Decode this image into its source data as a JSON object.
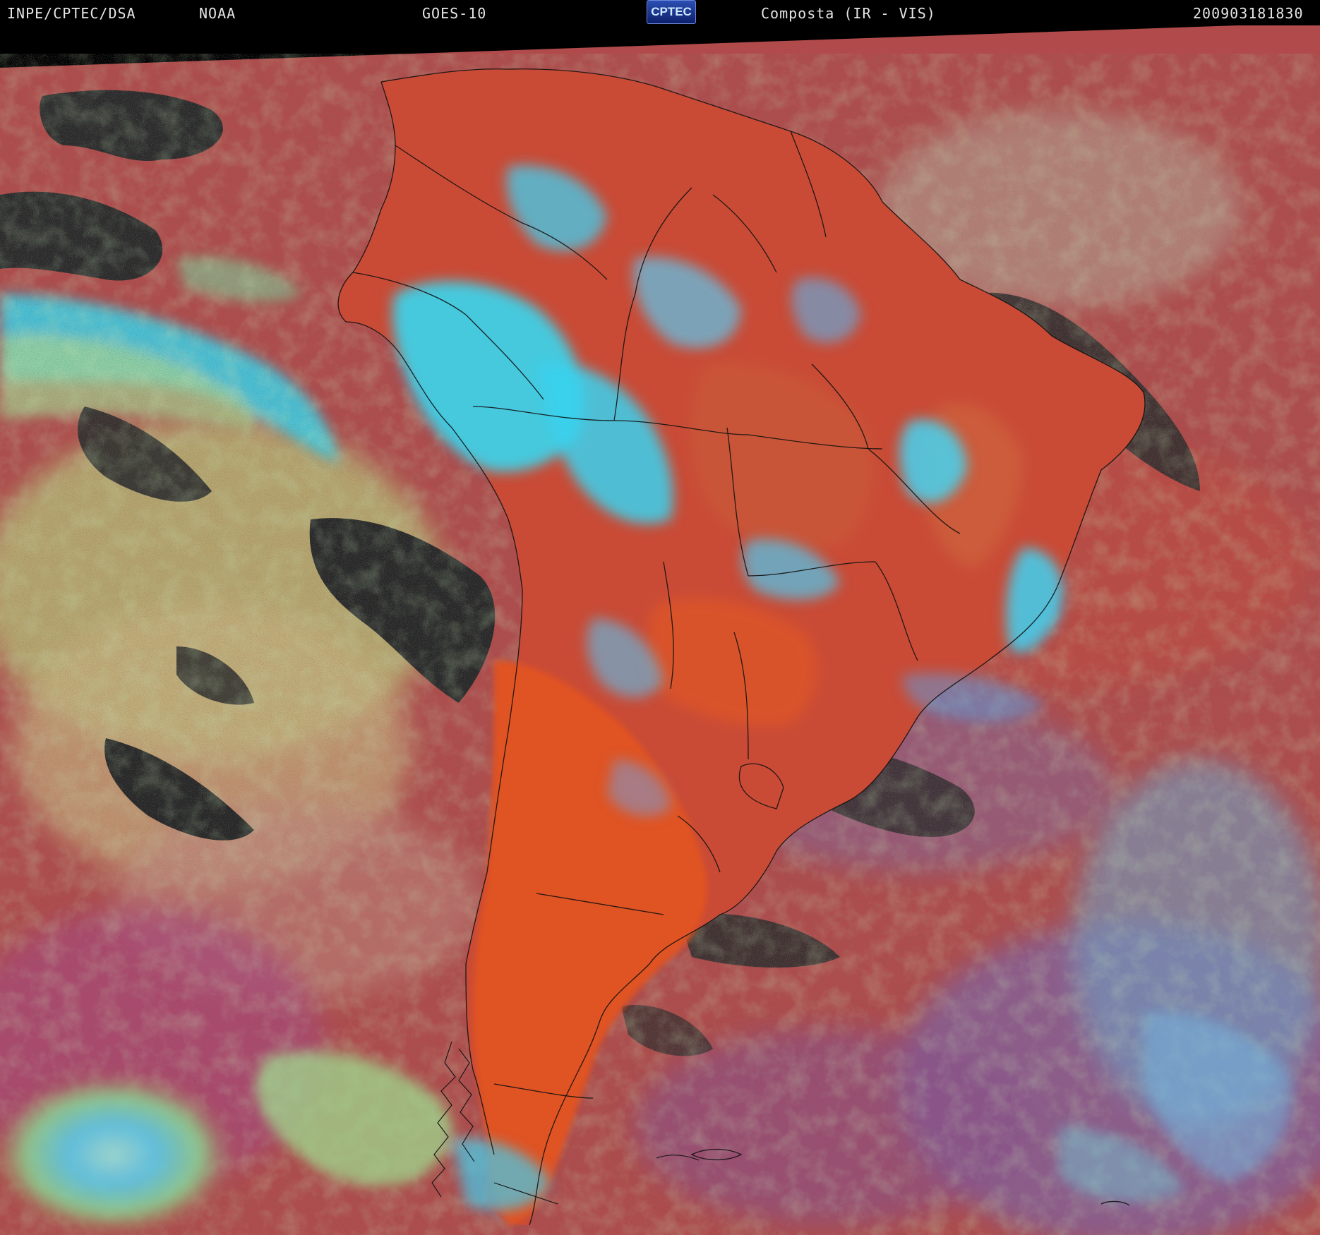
{
  "header": {
    "source": "INPE/CPTEC/DSA",
    "agency": "NOAA",
    "satellite": "GOES-10",
    "product": "Composta (IR - VIS)",
    "timestamp": "200903181830",
    "logo_text": "CPTEC"
  },
  "colors": {
    "header_bg": "#000000",
    "header_text": "#e6e6e6",
    "ocean_red": "#b14a4a",
    "land_orange": "#d8502a",
    "cold_cloud_cyan": "#35d8f2",
    "low_cloud_green": "#b9c479",
    "clear_dark": "#262626",
    "border_lines": "#111111"
  }
}
